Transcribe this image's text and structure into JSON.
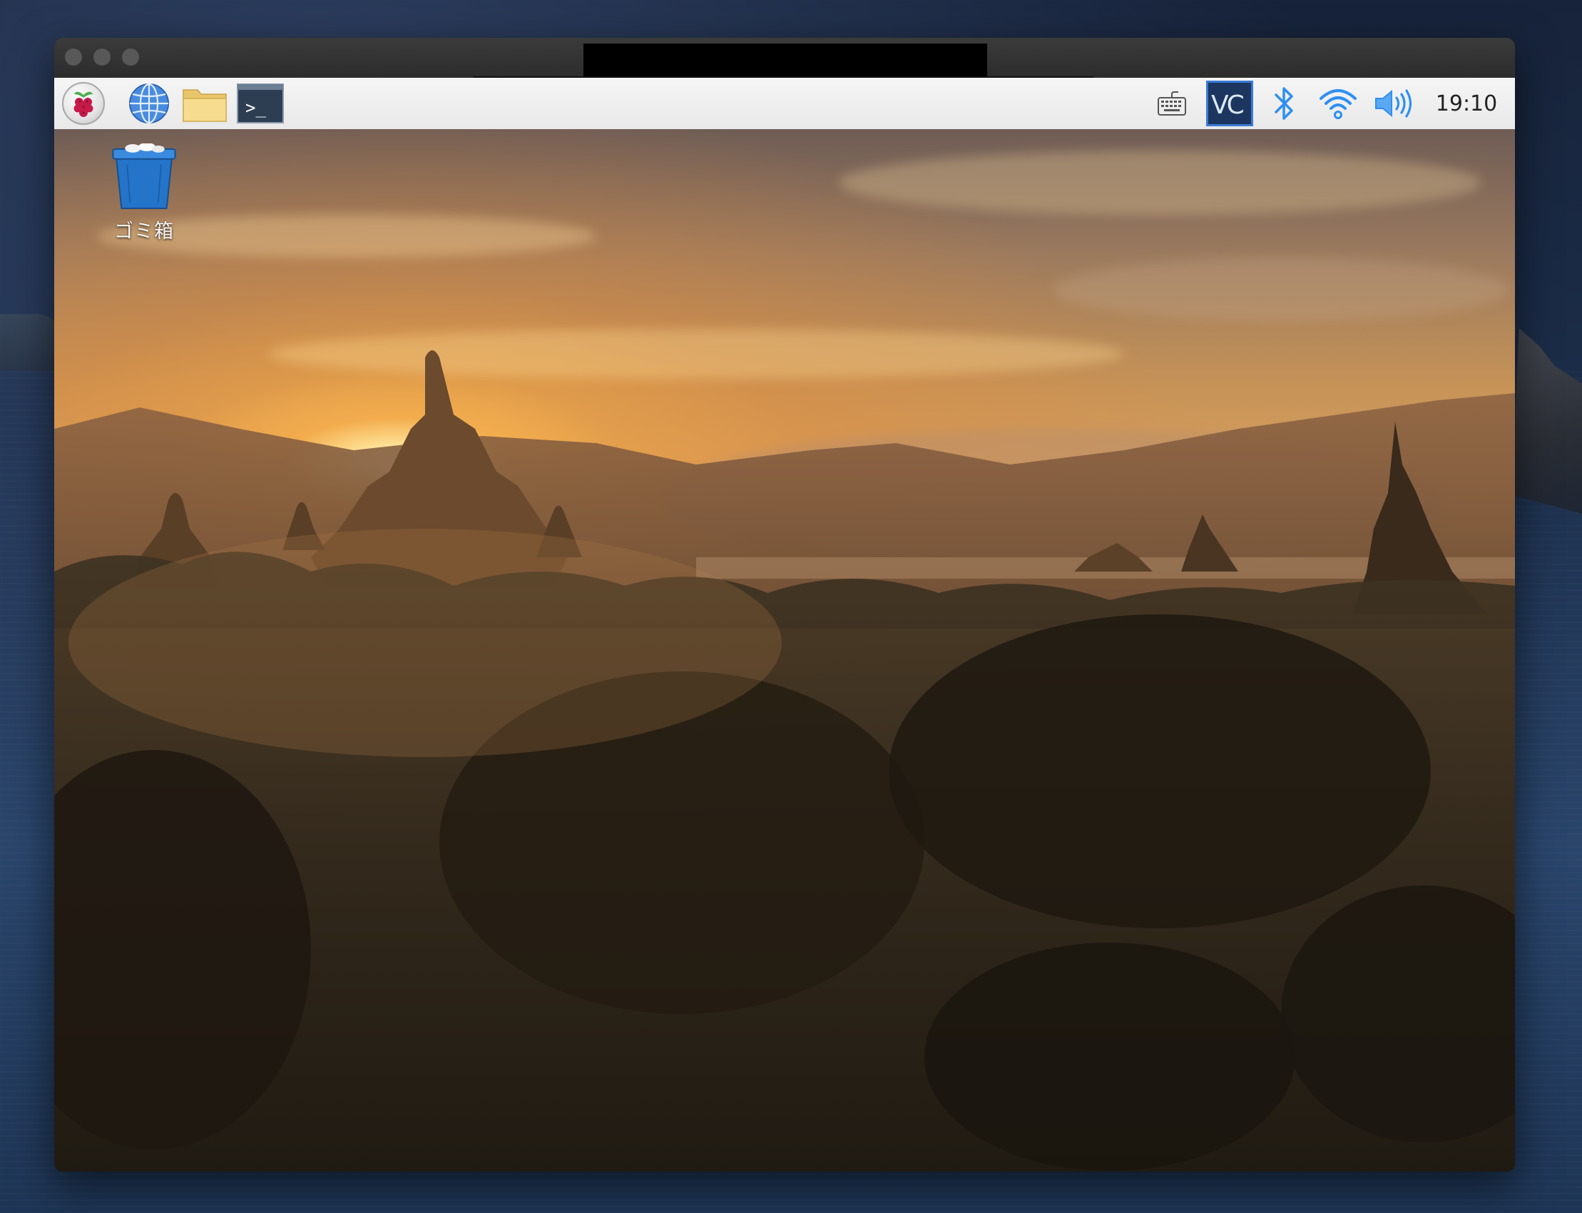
{
  "window": {
    "title_redacted": true
  },
  "taskbar": {
    "launchers": [
      {
        "name": "raspberry-menu",
        "icon": "raspberry-icon"
      },
      {
        "name": "web-browser",
        "icon": "globe-icon"
      },
      {
        "name": "file-manager",
        "icon": "folder-icon"
      },
      {
        "name": "terminal",
        "icon": "terminal-icon"
      }
    ],
    "tray": [
      {
        "name": "keyboard",
        "icon": "keyboard-icon"
      },
      {
        "name": "vnc-server",
        "icon": "vnc-icon"
      },
      {
        "name": "bluetooth",
        "icon": "bluetooth-icon"
      },
      {
        "name": "wifi",
        "icon": "wifi-icon"
      },
      {
        "name": "volume",
        "icon": "volume-icon"
      }
    ],
    "terminal_glyph": ">_",
    "vnc_glyph": "VC",
    "clock": "19:10"
  },
  "desktop": {
    "trash_label": "ゴミ箱"
  },
  "colors": {
    "taskbar_bg": "#ececec",
    "vnc_accent": "#3a7bd5",
    "tray_blue": "#2f8ff0",
    "trash_blue": "#2474c9"
  }
}
